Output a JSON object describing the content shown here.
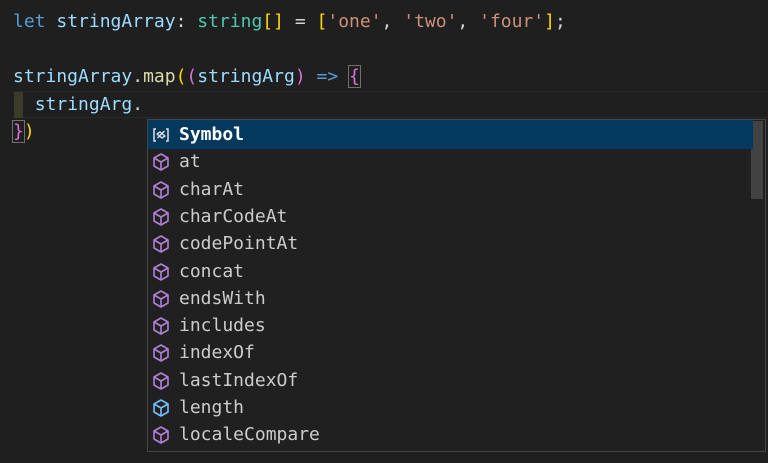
{
  "code": {
    "line1": {
      "kw": "let",
      "var": "stringArray",
      "colon": ":",
      "type": "string",
      "brackets_open": "[",
      "brackets_close": "]",
      "eq": "=",
      "arr_open": "[",
      "s1": "'one'",
      "c1": ",",
      "s2": "'two'",
      "c2": ",",
      "s3": "'four'",
      "arr_close": "]",
      "semi": ";"
    },
    "line3": {
      "var": "stringArray",
      "dot": ".",
      "fn": "map",
      "p_open": "(",
      "p2_open": "(",
      "param": "stringArg",
      "p2_close": ")",
      "arrow": "=>",
      "brace": "{"
    },
    "line4": {
      "var": "stringArg",
      "dot": "."
    },
    "line5": {
      "brace": "}",
      "paren": ")"
    }
  },
  "suggestions": {
    "items": [
      {
        "label": "Symbol",
        "icon": "keyword-symbol-icon",
        "selected": true
      },
      {
        "label": "at",
        "icon": "method-cube-icon"
      },
      {
        "label": "charAt",
        "icon": "method-cube-icon"
      },
      {
        "label": "charCodeAt",
        "icon": "method-cube-icon"
      },
      {
        "label": "codePointAt",
        "icon": "method-cube-icon"
      },
      {
        "label": "concat",
        "icon": "method-cube-icon"
      },
      {
        "label": "endsWith",
        "icon": "method-cube-icon"
      },
      {
        "label": "includes",
        "icon": "method-cube-icon"
      },
      {
        "label": "indexOf",
        "icon": "method-cube-icon"
      },
      {
        "label": "lastIndexOf",
        "icon": "method-cube-icon"
      },
      {
        "label": "length",
        "icon": "field-cube-icon"
      },
      {
        "label": "localeCompare",
        "icon": "method-cube-icon"
      }
    ]
  },
  "colors": {
    "method": "#b180d7",
    "field": "#75beff",
    "selected_bg": "#04395e"
  }
}
